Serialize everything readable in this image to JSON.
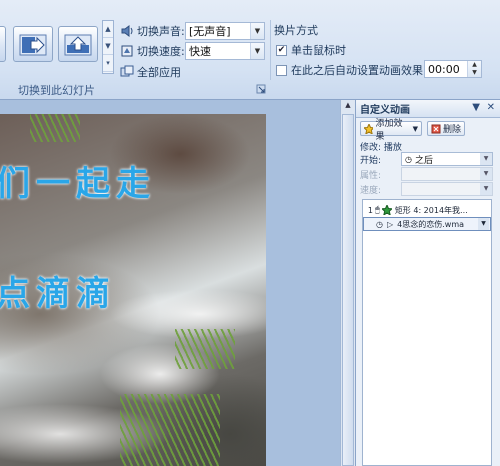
{
  "ribbon": {
    "sound_label": "切换声音:",
    "sound_value": "[无声音]",
    "speed_label": "切换速度:",
    "speed_value": "快速",
    "apply_all_label": "全部应用",
    "advance_title": "换片方式",
    "on_click_label": "单击鼠标时",
    "on_click_checked": true,
    "auto_after_label": "在此之后自动设置动画效果:",
    "auto_after_checked": false,
    "auto_after_time": "00:00",
    "group_label": "切换到此幻灯片"
  },
  "slide": {
    "line1": "们一起走",
    "line2": "点滴滴"
  },
  "pane": {
    "title": "自定义动画",
    "add_effect_label": "添加效果",
    "remove_label": "删除",
    "modify_label": "修改: 播放",
    "start_label": "开始:",
    "start_value": "之后",
    "property_label": "属性:",
    "speed_label": "速度:",
    "items": [
      {
        "index": "1",
        "text": "矩形 4: 2014年我..."
      },
      {
        "index": "",
        "text": "4思念的恋伤.wma"
      }
    ]
  },
  "colors": {
    "slide_text": "#2aa6e8",
    "ribbon_bg": "#dbe6f5"
  }
}
